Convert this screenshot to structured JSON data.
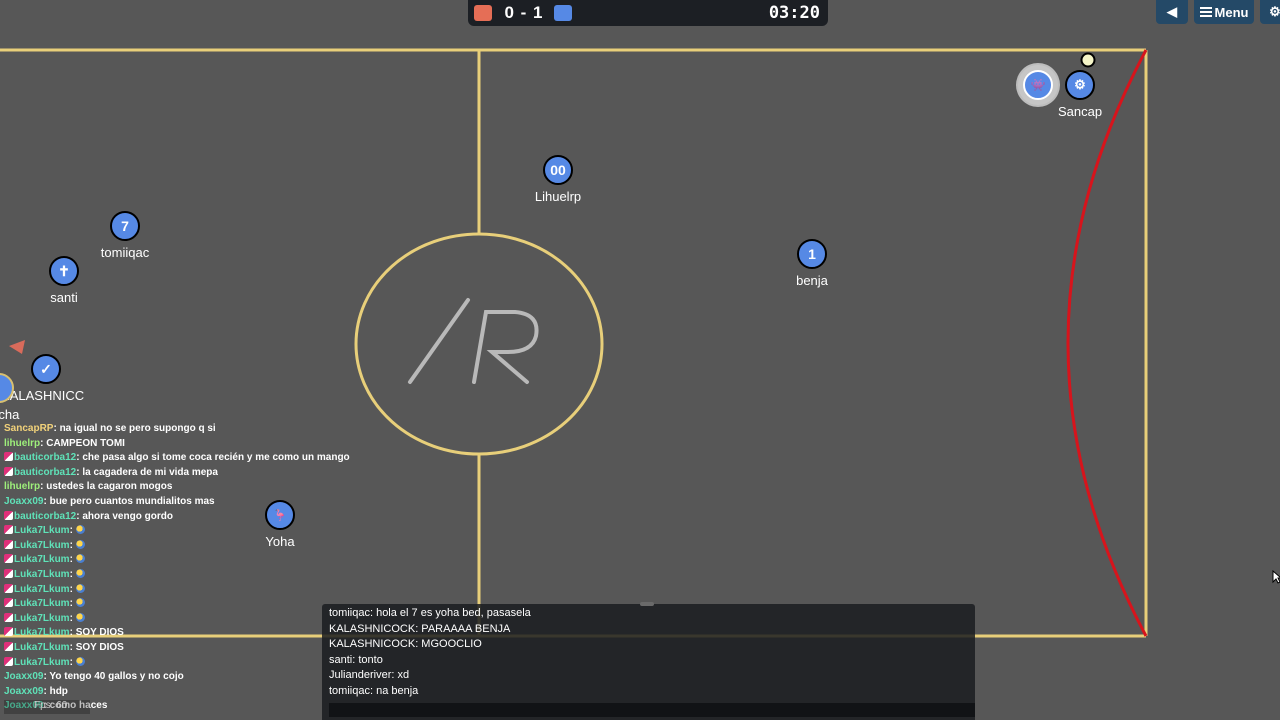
{
  "scoreboard": {
    "score": "0 - 1",
    "time": "03:20",
    "red_color": "#e56e56",
    "blue_color": "#5689e5"
  },
  "top_right": {
    "sound_icon": "speaker-icon",
    "menu_label": "Menu",
    "settings_icon": "gear-icon"
  },
  "players": [
    {
      "name": "Lihuelrp",
      "avatar": "00"
    },
    {
      "name": "tomiiqac",
      "avatar": "7"
    },
    {
      "name": "santi",
      "avatar": "✝"
    },
    {
      "name": "benja",
      "avatar": "1"
    },
    {
      "name": "KALASHNICC",
      "avatar": "✓"
    },
    {
      "name": "archa",
      "avatar": ""
    },
    {
      "name": "Yoha",
      "avatar": "🦩"
    },
    {
      "name": "Sancap",
      "avatar": "⚙"
    },
    {
      "name": "",
      "avatar": "👾"
    }
  ],
  "left_chat": [
    {
      "name": "SancapRP",
      "msg": "na igual no se pero supongo q si",
      "icon": false,
      "color": "yellow"
    },
    {
      "name": "lihuelrp",
      "msg": "CAMPEON TOMI",
      "icon": false,
      "color": "green"
    },
    {
      "name": "bauticorba12",
      "msg": "che pasa algo si tome coca recién y me como un mango",
      "icon": true,
      "color": "teal"
    },
    {
      "name": "bauticorba12",
      "msg": "la cagadera de mi vida mepa",
      "icon": true,
      "color": "teal"
    },
    {
      "name": "lihuelrp",
      "msg": "ustedes la cagaron mogos",
      "icon": false,
      "color": "green"
    },
    {
      "name": "Joaxx09",
      "msg": "bue pero cuantos mundialitos mas",
      "icon": false,
      "color": "teal"
    },
    {
      "name": "bauticorba12",
      "msg": "ahora vengo gordo",
      "icon": true,
      "color": "teal"
    },
    {
      "name": "Luka7Lkum",
      "msg": "",
      "icon": true,
      "color": "teal",
      "emoji": true
    },
    {
      "name": "Luka7Lkum",
      "msg": "",
      "icon": true,
      "color": "teal",
      "emoji": true
    },
    {
      "name": "Luka7Lkum",
      "msg": "",
      "icon": true,
      "color": "teal",
      "emoji": true
    },
    {
      "name": "Luka7Lkum",
      "msg": "",
      "icon": true,
      "color": "teal",
      "emoji": true
    },
    {
      "name": "Luka7Lkum",
      "msg": "",
      "icon": true,
      "color": "teal",
      "emoji": true
    },
    {
      "name": "Luka7Lkum",
      "msg": "",
      "icon": true,
      "color": "teal",
      "emoji": true
    },
    {
      "name": "Luka7Lkum",
      "msg": "",
      "icon": true,
      "color": "teal",
      "emoji": true
    },
    {
      "name": "Luka7Lkum",
      "msg": "SOY DIOS",
      "icon": true,
      "color": "teal"
    },
    {
      "name": "Luka7Lkum",
      "msg": "SOY DIOS",
      "icon": true,
      "color": "teal"
    },
    {
      "name": "Luka7Lkum",
      "msg": "",
      "icon": true,
      "color": "teal",
      "emoji": true
    },
    {
      "name": "Joaxx09",
      "msg": "Yo tengo 40 gallos y no cojo",
      "icon": false,
      "color": "teal"
    },
    {
      "name": "Joaxx09",
      "msg": "hdp",
      "icon": false,
      "color": "teal"
    },
    {
      "name": "Joaxx09",
      "msg": "como haces",
      "icon": false,
      "color": "teal"
    }
  ],
  "fps_label": "Fps: 60",
  "bottom_chat": {
    "lines": [
      "tomiiqac: hola el 7 es yoha bed, pasasela",
      "KALASHNICOCK: PARAAAA BENJA",
      "KALASHNICOCK: MGOOCLIO",
      "santi: tonto",
      "Julianderiver: xd",
      "tomiiqac: na benja"
    ],
    "input_value": ""
  }
}
